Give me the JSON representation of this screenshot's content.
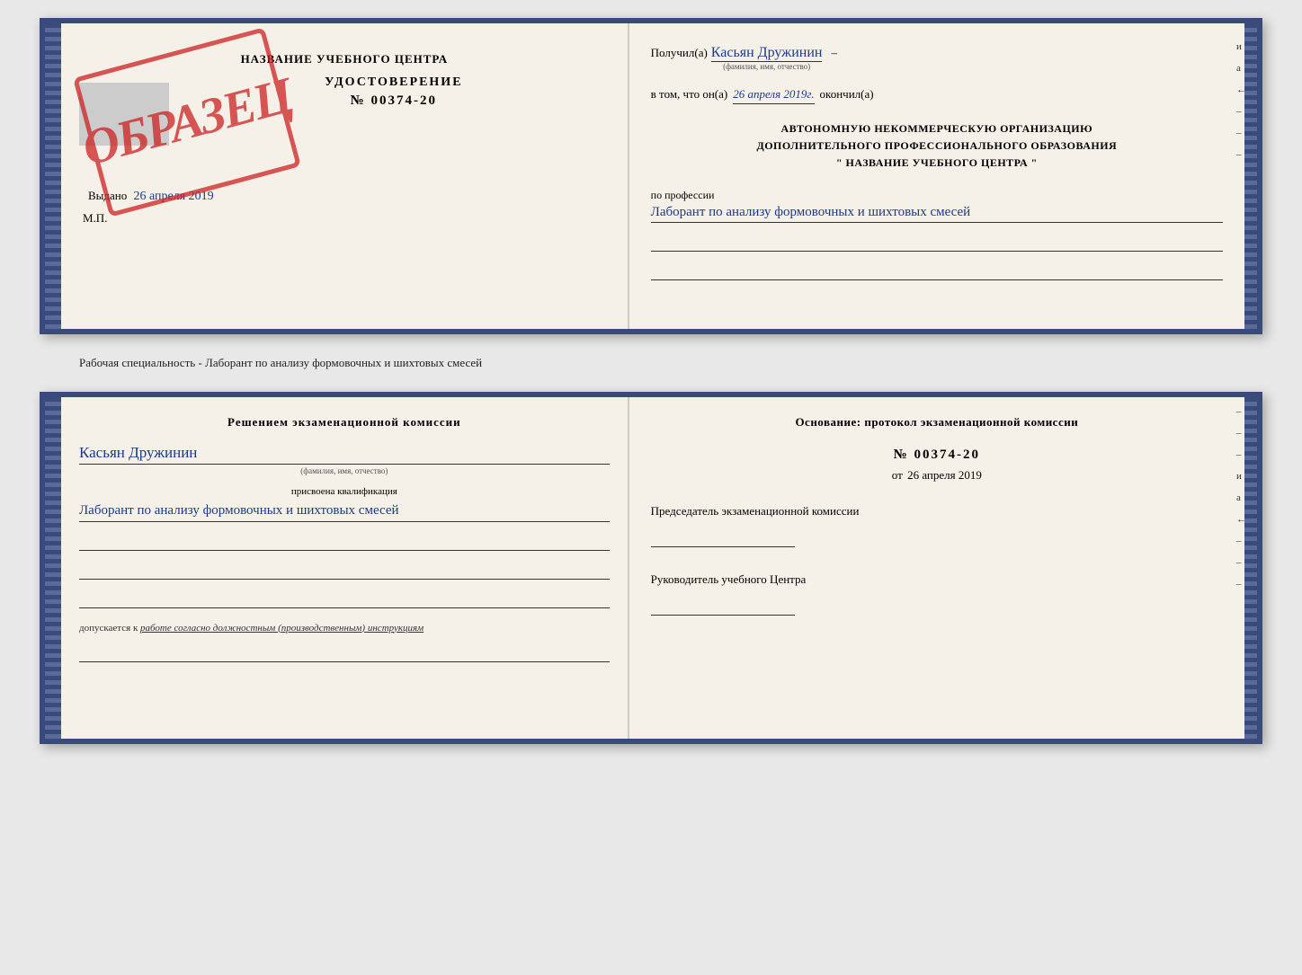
{
  "topDoc": {
    "left": {
      "title": "НАЗВАНИЕ УЧЕБНОГО ЦЕНТРА",
      "certLabel": "УДОСТОВЕРЕНИЕ",
      "certNumber": "№ 00374-20",
      "issuedText": "Выдано",
      "issuedDate": "26 апреля 2019",
      "mpLabel": "М.П.",
      "obrazecText": "ОБРАЗЕЦ"
    },
    "right": {
      "receivedLabel": "Получил(а)",
      "receivedName": "Касьян Дружинин",
      "receivedSubLabel": "(фамилия, имя, отчество)",
      "dashText": "–",
      "inThatLabel": "в том, что он(а)",
      "completedDate": "26 апреля 2019г.",
      "completedLabel": "окончил(а)",
      "orgLine1": "АВТОНОМНУЮ НЕКОММЕРЧЕСКУЮ ОРГАНИЗАЦИЮ",
      "orgLine2": "ДОПОЛНИТЕЛЬНОГО ПРОФЕССИОНАЛЬНОГО ОБРАЗОВАНИЯ",
      "orgLine3": "\"   НАЗВАНИЕ УЧЕБНОГО ЦЕНТРА   \"",
      "professionLabel": "по профессии",
      "professionHandwritten": "Лаборант по анализу формовочных и шихтовых смесей",
      "sideMarks": [
        "и",
        "а",
        "←",
        "–",
        "–",
        "–"
      ]
    }
  },
  "separatorText": "Рабочая специальность - Лаборант по анализу формовочных и шихтовых смесей",
  "bottomDoc": {
    "left": {
      "decisionTitle": "Решением экзаменационной комиссии",
      "name": "Касьян Дружинин",
      "nameSubLabel": "(фамилия, имя, отчество)",
      "qualificationLabel": "присвоена квалификация",
      "qualificationText": "Лаборант по анализу формовочных и шихтовых смесей",
      "допускаетсяText": "допускается к",
      "допускаетсяUnderline": "работе согласно должностным (производственным) инструкциям"
    },
    "right": {
      "basisLabel": "Основание: протокол экзаменационной комиссии",
      "protocolNumber": "№ 00374-20",
      "dateLabel": "от",
      "dateValue": "26 апреля 2019",
      "chairmanLabel": "Председатель экзаменационной комиссии",
      "headLabel": "Руководитель учебного Центра",
      "sideMarks": [
        "–",
        "–",
        "–",
        "и",
        "а",
        "←",
        "–",
        "–",
        "–"
      ]
    }
  }
}
